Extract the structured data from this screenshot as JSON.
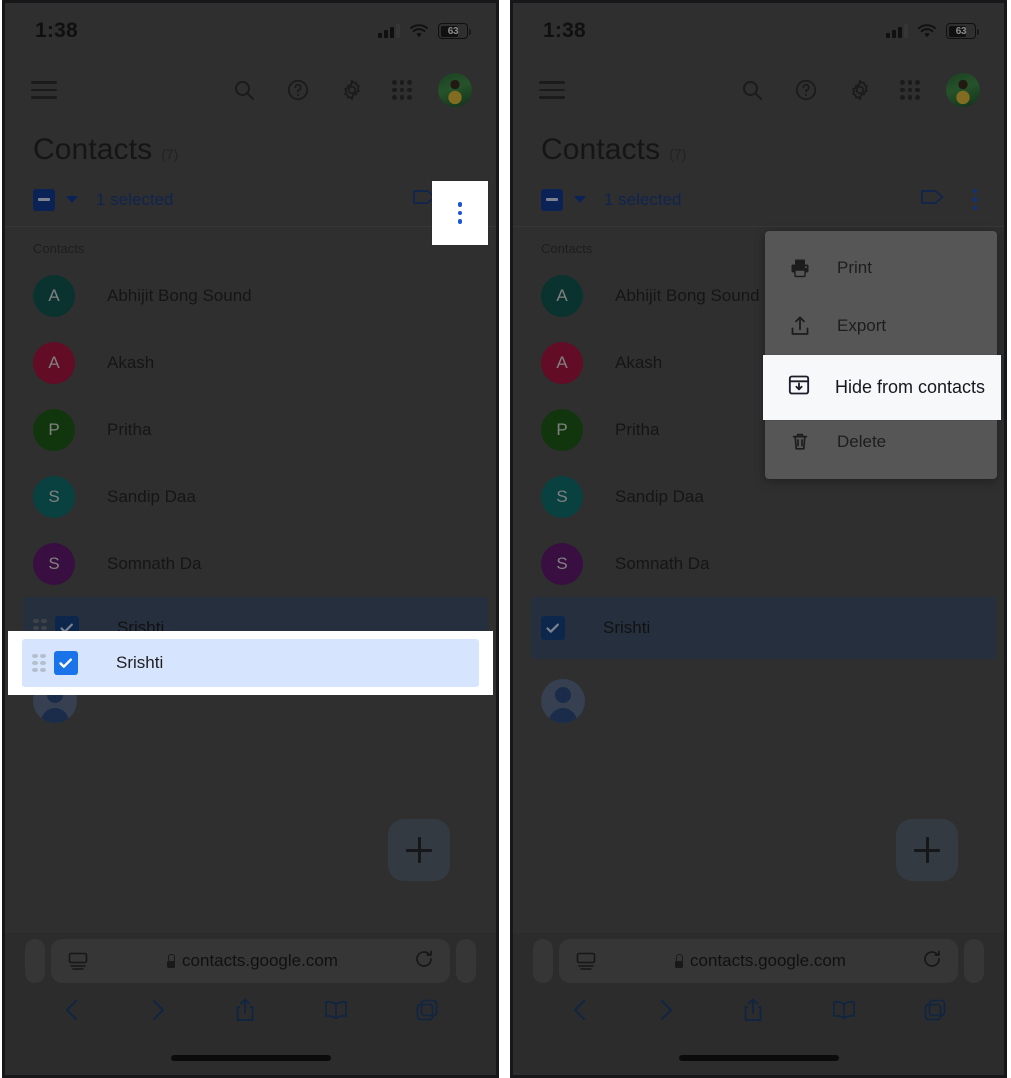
{
  "status_bar": {
    "time": "1:38",
    "battery_level": "63",
    "signal_icon": "cellular-signal-icon",
    "wifi_icon": "wifi-icon",
    "battery_icon": "battery-icon"
  },
  "app_bar": {
    "menu_icon": "hamburger-menu-icon",
    "search_icon": "search-icon",
    "help_icon": "help-circle-icon",
    "settings_icon": "gear-icon",
    "apps_icon": "google-apps-grid-icon",
    "avatar_icon": "account-avatar"
  },
  "page": {
    "title": "Contacts",
    "count": "(7)"
  },
  "selection_bar": {
    "checkbox_state": "indeterminate",
    "dropdown_icon": "chevron-down-icon",
    "selected_text": "1 selected",
    "label_icon": "label-tag-icon",
    "more_icon": "more-vert-icon"
  },
  "list": {
    "section_header": "Contacts",
    "contacts": [
      {
        "initial": "A",
        "name": "Abhijit Bong Sound",
        "color": "#11564f"
      },
      {
        "initial": "A",
        "name": "Akash",
        "color": "#a3143f"
      },
      {
        "initial": "P",
        "name": "Pritha",
        "color": "#1d5b16"
      },
      {
        "initial": "S",
        "name": "Sandip Daa",
        "color": "#106b6b"
      },
      {
        "initial": "S",
        "name": "Somnath Da",
        "color": "#5e1a6b"
      }
    ],
    "selected_contact": {
      "name": "Srishti",
      "checked": true,
      "drag_handle_icon": "drag-handle-dots-icon",
      "checkbox_icon": "checkbox-checked-icon"
    },
    "placeholder_avatar_icon": "person-placeholder-icon"
  },
  "fab": {
    "icon": "plus-icon",
    "label": "+"
  },
  "menu": {
    "items": [
      {
        "label": "Print",
        "icon": "printer-icon",
        "highlighted": false
      },
      {
        "label": "Export",
        "icon": "export-upload-icon",
        "highlighted": false
      },
      {
        "label": "Hide from contacts",
        "icon": "archive-box-down-icon",
        "highlighted": true
      },
      {
        "label": "Delete",
        "icon": "trash-icon",
        "highlighted": false
      }
    ],
    "highlighted_label": "Hide from contacts"
  },
  "browser": {
    "reader_icon": "reader-view-icon",
    "lock_icon": "lock-icon",
    "url": "contacts.google.com",
    "reload_icon": "reload-icon",
    "back_icon": "back-chevron-icon",
    "forward_icon": "forward-chevron-icon",
    "share_icon": "share-icon",
    "bookmarks_icon": "bookmarks-book-icon",
    "tabs_icon": "tabs-icon"
  },
  "colors": {
    "accent_blue": "#1a73e8",
    "selection_row_blue": "#d6e4fd",
    "menu_highlight": "#f7f8fa",
    "dim_overlay": "rgba(0,0,0,0.55)"
  }
}
